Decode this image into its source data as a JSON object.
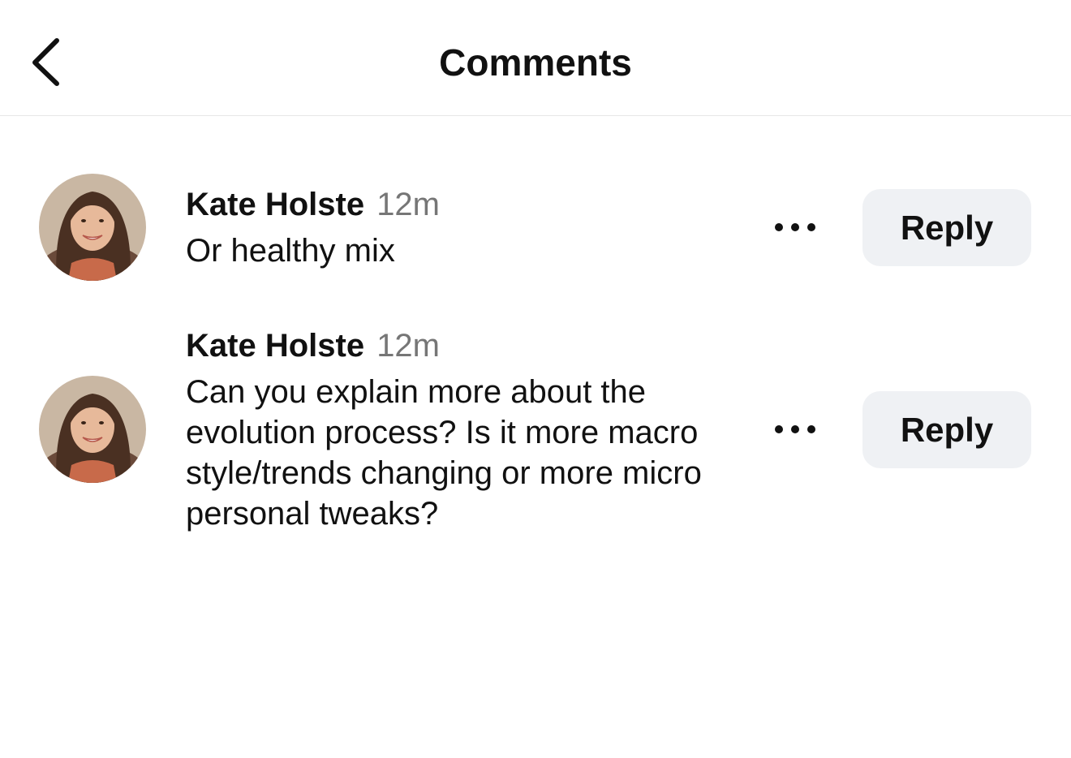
{
  "header": {
    "title": "Comments",
    "back_icon": "chevron-left-icon"
  },
  "comments": [
    {
      "author": "Kate Holste",
      "time": "12m",
      "text": "Or healthy mix",
      "more_icon": "more-horizontal-icon",
      "reply_label": "Reply"
    },
    {
      "author": "Kate Holste",
      "time": "12m",
      "text": "Can you explain more about the evolution process? Is it more macro style/trends changing or more micro personal tweaks?",
      "more_icon": "more-horizontal-icon",
      "reply_label": "Reply"
    }
  ],
  "colors": {
    "background": "#ffffff",
    "text": "#111111",
    "timestamp": "#767676",
    "reply_button_bg": "#eff1f4",
    "divider": "#e6e6e6"
  }
}
